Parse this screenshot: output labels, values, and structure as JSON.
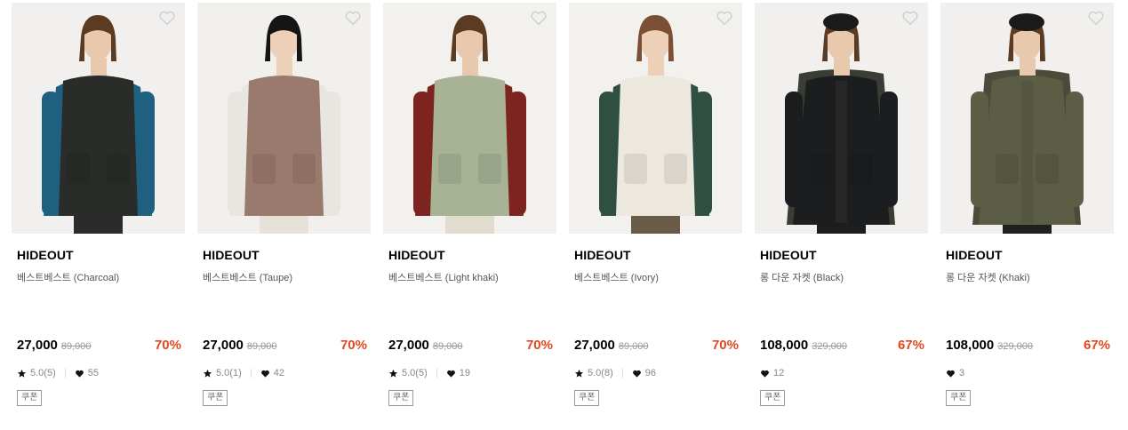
{
  "products": [
    {
      "brand": "HIDEOUT",
      "name": "베스트베스트 (Charcoal)",
      "price": "27,000",
      "original_price": "89,000",
      "discount": "70%",
      "rating": "5.0(5)",
      "likes": "55",
      "coupon": "쿠폰",
      "image": {
        "bg": "#f1f0ee",
        "top": "#1f5f80",
        "outer": "#2a2c2a",
        "pants": "#2b2b2b",
        "hair": "#5b3b22",
        "skin": "#e8c9ad"
      }
    },
    {
      "brand": "HIDEOUT",
      "name": "베스트베스트 (Taupe)",
      "price": "27,000",
      "original_price": "89,000",
      "discount": "70%",
      "rating": "5.0(1)",
      "likes": "42",
      "coupon": "쿠폰",
      "image": {
        "bg": "#f2f0ed",
        "top": "#e8e6e0",
        "outer": "#9a7a6c",
        "pants": "#e7e2d8",
        "hair": "#151515",
        "skin": "#ecd0b8"
      }
    },
    {
      "brand": "HIDEOUT",
      "name": "베스트베스트 (Light khaki)",
      "price": "27,000",
      "original_price": "89,000",
      "discount": "70%",
      "rating": "5.0(5)",
      "likes": "19",
      "coupon": "쿠폰",
      "image": {
        "bg": "#f2f1ee",
        "top": "#7d2420",
        "outer": "#a8b294",
        "pants": "#e2dccf",
        "hair": "#5b3b22",
        "skin": "#e8c9ad"
      }
    },
    {
      "brand": "HIDEOUT",
      "name": "베스트베스트 (Ivory)",
      "price": "27,000",
      "original_price": "89,000",
      "discount": "70%",
      "rating": "5.0(8)",
      "likes": "96",
      "coupon": "쿠폰",
      "image": {
        "bg": "#f2f1ee",
        "top": "#2f4f43",
        "outer": "#ece8de",
        "pants": "#6a5a48",
        "hair": "#7b4f33",
        "skin": "#ecd0b8"
      }
    },
    {
      "brand": "HIDEOUT",
      "name": "롱 다운 자켓 (Black)",
      "price": "108,000",
      "original_price": "329,000",
      "discount": "67%",
      "rating": "",
      "likes": "12",
      "coupon": "쿠폰",
      "image": {
        "bg": "#f1f0ee",
        "top": "#3a3d33",
        "outer": "#1c1d1f",
        "pants": "#1c1d1f",
        "hair": "#5b3b22",
        "skin": "#e8c9ad",
        "hat": "#1a1a1a"
      }
    },
    {
      "brand": "HIDEOUT",
      "name": "롱 다운 자켓 (Khaki)",
      "price": "108,000",
      "original_price": "329,000",
      "discount": "67%",
      "rating": "",
      "likes": "3",
      "coupon": "쿠폰",
      "image": {
        "bg": "#f1f0ee",
        "top": "#4a4b3a",
        "outer": "#5b5d44",
        "pants": "#202020",
        "hair": "#5b3b22",
        "skin": "#e8c9ad",
        "hat": "#1a1a1a"
      }
    }
  ],
  "icons": {
    "wishlist": "heart-outline-icon",
    "rating": "star-icon",
    "likes": "heart-icon"
  },
  "colors": {
    "discount": "#e2471d",
    "text": "#000000",
    "subtext": "#555555"
  }
}
